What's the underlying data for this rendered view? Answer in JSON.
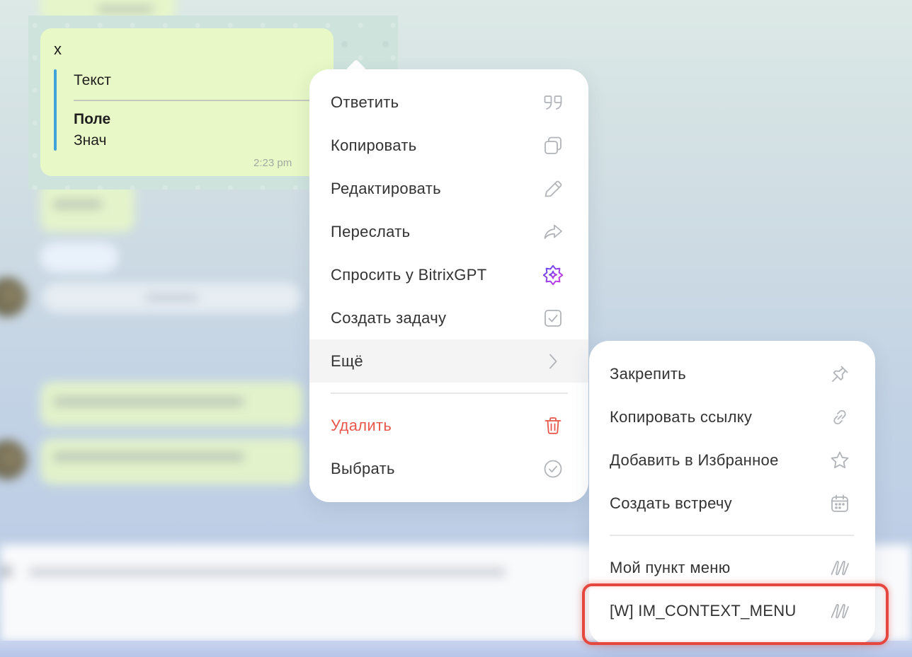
{
  "chat": {
    "selected_message": {
      "text": "x",
      "attachment_title": "Текст",
      "field_name": "Поле",
      "field_value": "Знач",
      "time": "2:23 pm"
    }
  },
  "context_menu": {
    "items": [
      {
        "label": "Ответить",
        "icon": "quote-icon"
      },
      {
        "label": "Копировать",
        "icon": "copy-icon"
      },
      {
        "label": "Редактировать",
        "icon": "pencil-icon"
      },
      {
        "label": "Переслать",
        "icon": "forward-icon"
      },
      {
        "label": "Спросить у BitrixGPT",
        "icon": "bitrixgpt-icon"
      },
      {
        "label": "Создать задачу",
        "icon": "task-checkbox-icon"
      },
      {
        "label": "Ещё",
        "icon": "chevron-right-icon",
        "highlighted": true
      }
    ],
    "secondary_items": [
      {
        "label": "Удалить",
        "icon": "trash-icon",
        "danger": true
      },
      {
        "label": "Выбрать",
        "icon": "circle-check-icon"
      }
    ]
  },
  "submenu": {
    "items": [
      {
        "label": "Закрепить",
        "icon": "pin-icon"
      },
      {
        "label": "Копировать ссылку",
        "icon": "link-icon"
      },
      {
        "label": "Добавить в Избранное",
        "icon": "star-icon"
      },
      {
        "label": "Создать встречу",
        "icon": "calendar-icon"
      }
    ],
    "app_items": [
      {
        "label": "Мой пункт меню",
        "icon": "custom-app-icon"
      },
      {
        "label": "[W] IM_CONTEXT_MENU",
        "icon": "custom-app-icon",
        "annotated": true
      }
    ]
  },
  "colors": {
    "menu_text": "#333333",
    "icon": "#b1b4b8",
    "danger": "#e8574b",
    "bubble": "#e8f8c6",
    "quote_bar": "#3fa3da",
    "hover_bg": "#f4f4f5",
    "annotation": "#e5463d",
    "gpt_gradient_start": "#5b4cf0",
    "gpt_gradient_end": "#d43ade"
  }
}
